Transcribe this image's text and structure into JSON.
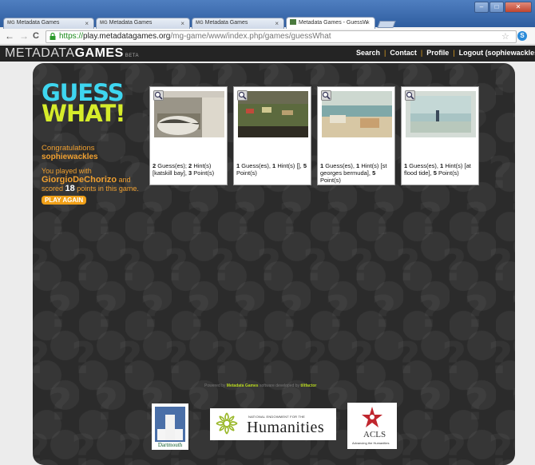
{
  "browser": {
    "tabs": [
      {
        "prefix": "MG",
        "title": "Metadata Games",
        "active": false
      },
      {
        "prefix": "MG",
        "title": "Metadata Games",
        "active": false
      },
      {
        "prefix": "MG",
        "title": "Metadata Games",
        "active": false
      },
      {
        "prefix": "",
        "title": "Metadata Games - GuessW",
        "active": true
      }
    ],
    "close_glyph": "×",
    "url_scheme": "https://",
    "url_host": "play.metadatagames.org",
    "url_path": "/mg-game/www/index.php/games/guessWhat",
    "back": "←",
    "forward": "→",
    "reload": "C",
    "bookmark_star": "☆",
    "extension_label": "S"
  },
  "site": {
    "logo_light": "METADATA",
    "logo_bold": "GAMES",
    "logo_beta": "BETA",
    "nav": [
      "Search",
      "Contact",
      "Profile",
      "Logout (sophiewackles"
    ]
  },
  "game": {
    "title_line1": "GUESS",
    "title_line2": "WHAT!",
    "congrats_label": "Congratulations",
    "username": "sophiewackles",
    "played_prefix": "You played with",
    "opponent": "GiorgioDeChorizo",
    "played_suffix": "and",
    "scored_prefix": "scored",
    "points": "18",
    "scored_suffix": "points in this game.",
    "play_again": "PLAY AGAIN"
  },
  "results": [
    {
      "guesses": "2",
      "guesses_label": "Guess(es);",
      "hints": "2",
      "hints_label": "Hint(s) [katskill bay],",
      "points": "3",
      "points_label": "Point(s)"
    },
    {
      "guesses": "1",
      "guesses_label": "Guess(es),",
      "hints": "1",
      "hints_label": "Hint(s) [],",
      "points": "5",
      "points_label": "Point(s)"
    },
    {
      "guesses": "1",
      "guesses_label": "Guess(es),",
      "hints": "1",
      "hints_label": "Hint(s) [st georges bermuda],",
      "points": "5",
      "points_label": "Point(s)"
    },
    {
      "guesses": "1",
      "guesses_label": "Guess(es),",
      "hints": "1",
      "hints_label": "Hint(s) [at flood tide],",
      "points": "5",
      "points_label": "Point(s)"
    }
  ],
  "footer": {
    "powered_prefix": "Powered by",
    "powered_link": "Metadata Games",
    "powered_mid": "software developed by",
    "developer": "tiltfactor"
  },
  "sponsors": {
    "dartmouth": "Dartmouth",
    "neh_small": "NATIONAL ENDOWMENT FOR THE",
    "neh_big": "Humanities",
    "acls": "ACLS",
    "acls_sub": "Advancing the Humanities"
  },
  "colors": {
    "title_cyan": "#3ed6f0",
    "title_lime": "#d6ec2a",
    "accent_orange": "#f0a030",
    "panel": "#2b2b2b"
  }
}
